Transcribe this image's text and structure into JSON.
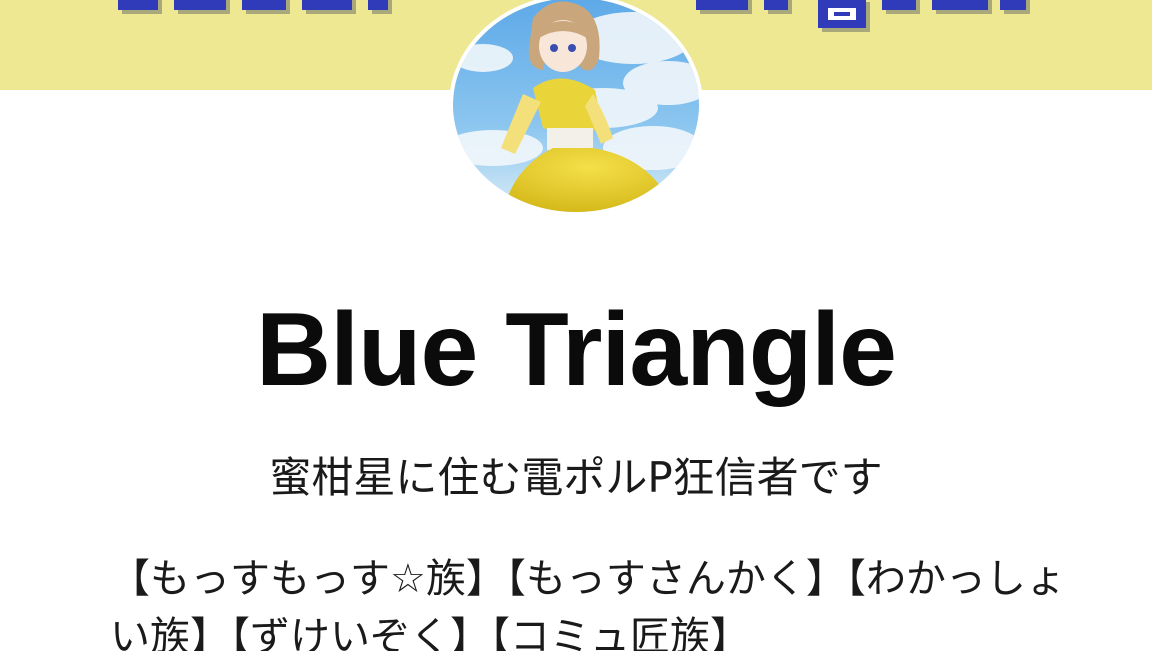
{
  "banner": {
    "background_color": "#ede891",
    "pixel_text_color": "#2f3bb8",
    "pixel_shadow_color": "#a8a87a"
  },
  "profile": {
    "avatar_description_icon": "avatar-illustration-icon",
    "display_name": "Blue Triangle",
    "bio_line": "蜜柑星に住む電ポルP狂信者です",
    "bio_tags": "【もっすもっす☆族】【もっすさんかく】【わかっしょい族】【ずけいぞく】【コミュ匠族】"
  }
}
